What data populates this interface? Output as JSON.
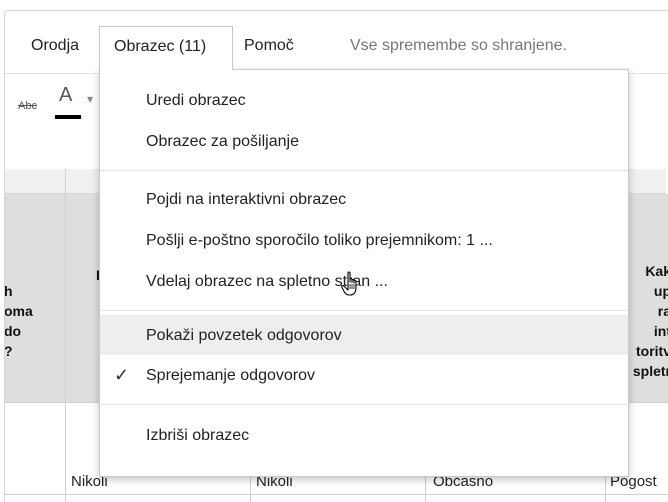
{
  "menubar": {
    "tools": "Orodja",
    "form": "Obrazec (11)",
    "help": "Pomoč",
    "save_status": "Vse spremembe so shranjene."
  },
  "toolbar": {
    "strikethrough": "Abc",
    "font_color": "A"
  },
  "form_menu": {
    "items": [
      {
        "label": "Uredi obrazec"
      },
      {
        "label": "Obrazec za pošiljanje"
      },
      {
        "label": "Pojdi na interaktivni obrazec"
      },
      {
        "label": "Pošlji e-poštno sporočilo toliko prejemnikom: 1 ..."
      },
      {
        "label": "Vdelaj obrazec na spletno stran ..."
      },
      {
        "label": "Pokaži povzetek odgovorov"
      },
      {
        "label": "Sprejemanje odgovorov",
        "checked": true
      },
      {
        "label": "Izbriši obrazec"
      }
    ],
    "check_mark": "✓"
  },
  "sheet": {
    "left_header_lines": [
      "h",
      "oma",
      "do",
      "?"
    ],
    "middle_header_partial": "H",
    "right_header_lines": [
      "Kak",
      "up",
      "ra",
      "int",
      "toritv",
      "spletr"
    ],
    "row1": [
      "Nikoli",
      "Nikoli",
      "Občasno",
      "Pogost"
    ]
  },
  "colors": {
    "accent_checked": "#333333",
    "header_bg": "#dedede",
    "hover_bg": "#eeeeee"
  }
}
